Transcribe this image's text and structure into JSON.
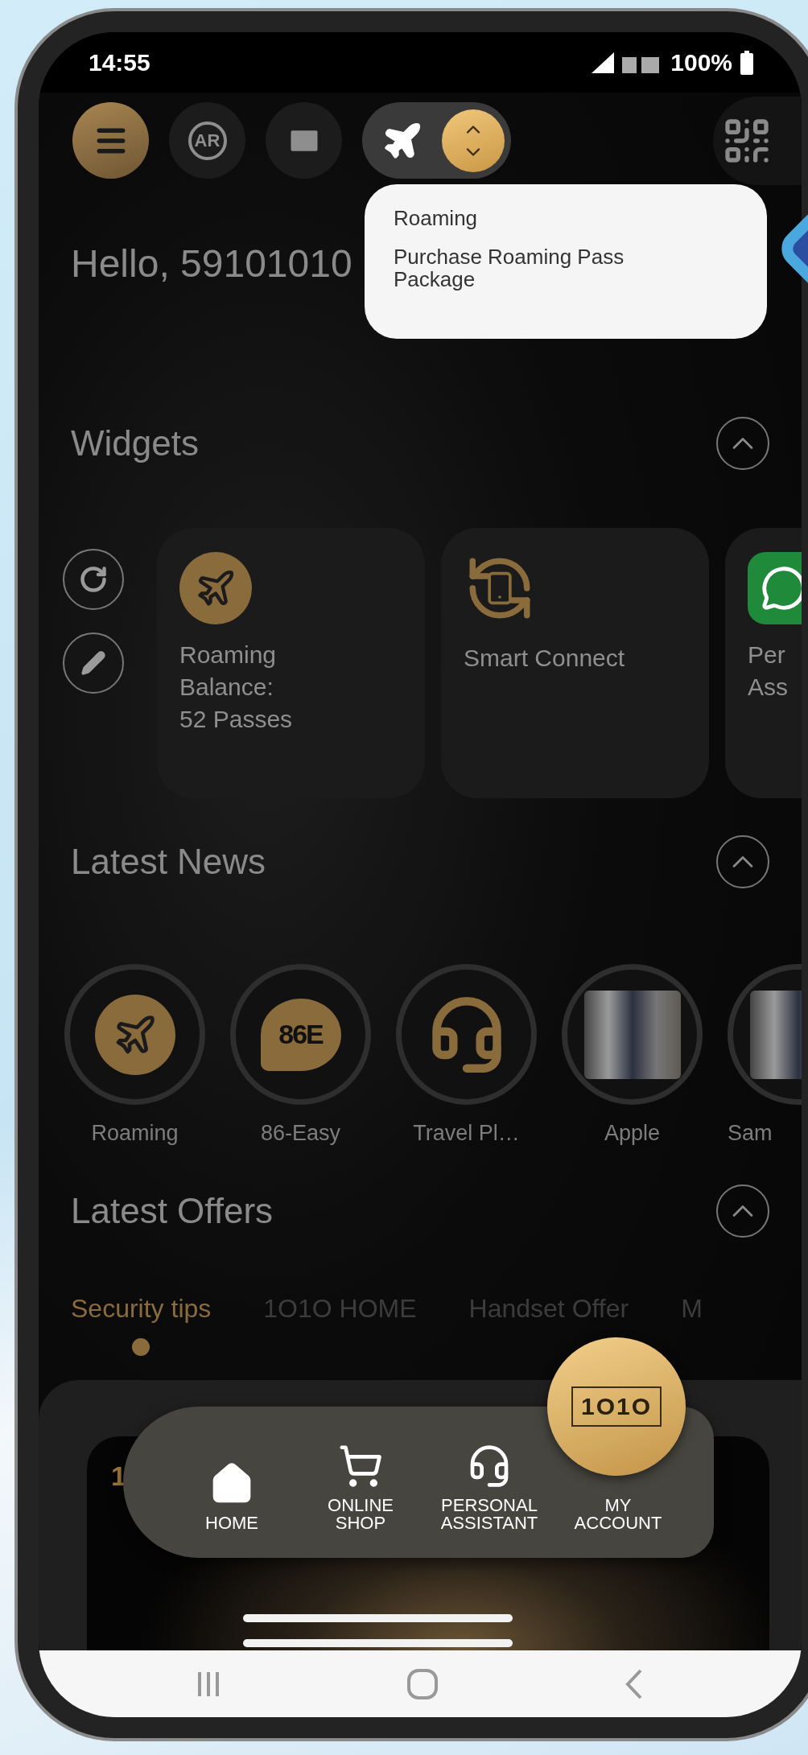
{
  "status_bar": {
    "time": "14:55",
    "battery": "100%"
  },
  "top_bar": {
    "ar_label": "AR"
  },
  "dropdown": {
    "open": true,
    "items": [
      "Roaming",
      "Purchase Roaming Pass Package"
    ]
  },
  "greeting": "Hello, 59101010",
  "widgets": {
    "title": "Widgets",
    "expanded": true,
    "cards": [
      {
        "kind": "roaming",
        "lines": [
          "Roaming",
          "Balance:",
          "52 Passes"
        ]
      },
      {
        "kind": "smart",
        "lines": [
          "Smart Connect"
        ]
      },
      {
        "kind": "chat",
        "lines": [
          "Per",
          "Ass"
        ]
      }
    ]
  },
  "news": {
    "title": "Latest News",
    "expanded": true,
    "items": [
      {
        "kind": "roaming",
        "label": "Roaming"
      },
      {
        "kind": "easy",
        "label": "86-Easy",
        "icon_text": "86E"
      },
      {
        "kind": "headset",
        "label": "Travel Pl…"
      },
      {
        "kind": "photo",
        "label": "Apple"
      },
      {
        "kind": "photo",
        "label": "Sam"
      }
    ]
  },
  "offers": {
    "title": "Latest Offers",
    "expanded": true,
    "tabs": [
      {
        "label": "Security tips",
        "selected": true
      },
      {
        "label": "1O1O HOME",
        "selected": false
      },
      {
        "label": "Handset Offer",
        "selected": false
      },
      {
        "label": "M",
        "selected": false
      }
    ],
    "card_text": "1"
  },
  "bottom_nav": {
    "logo": "1O1O",
    "items": [
      {
        "kind": "home",
        "lines": [
          "HOME"
        ]
      },
      {
        "kind": "shop",
        "lines": [
          "ONLINE",
          "SHOP"
        ]
      },
      {
        "kind": "assistant",
        "lines": [
          "PERSONAL",
          "ASSISTANT"
        ]
      },
      {
        "kind": "account",
        "lines": [
          "MY",
          "ACCOUNT"
        ]
      }
    ]
  }
}
